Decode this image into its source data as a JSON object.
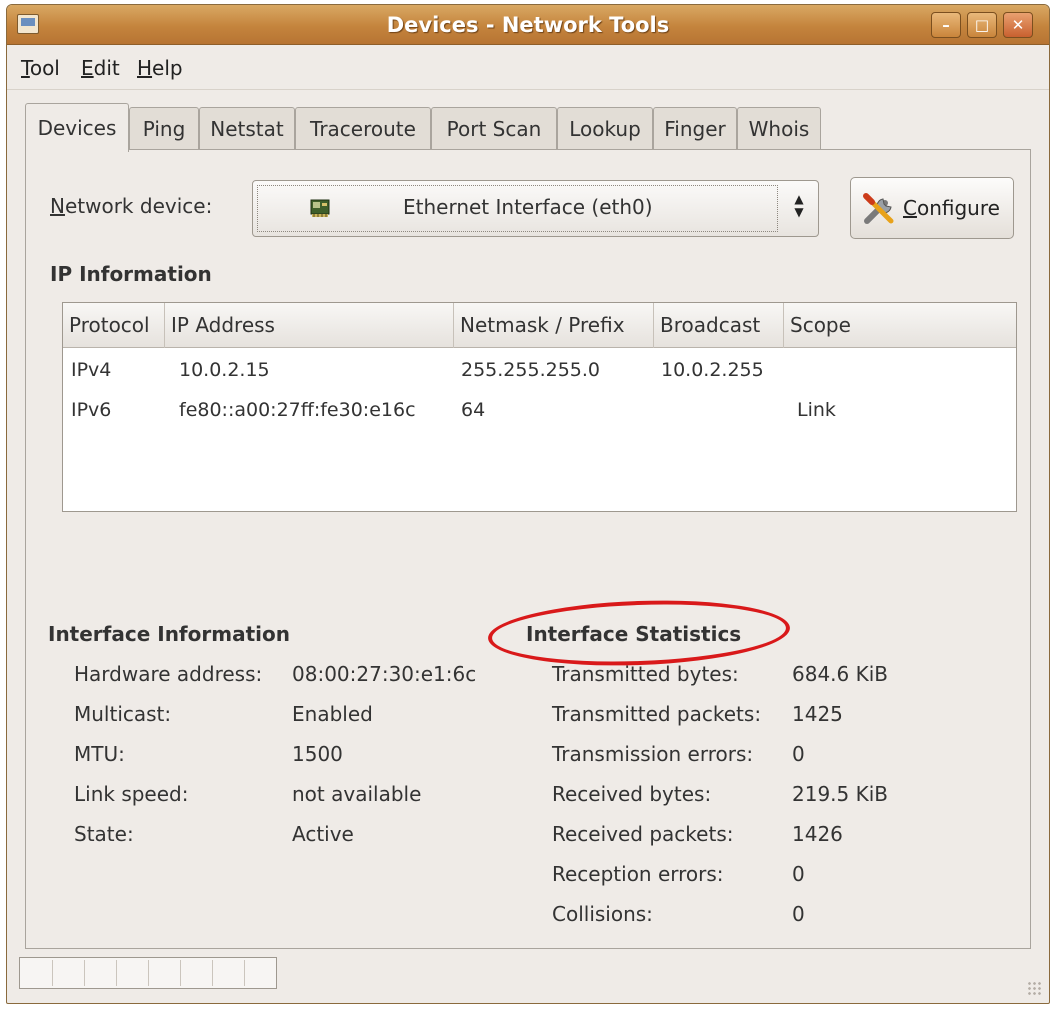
{
  "window": {
    "title": "Devices - Network Tools",
    "controls": {
      "minimize": "–",
      "maximize": "□",
      "close": "✕"
    }
  },
  "menu": {
    "items": [
      {
        "label": "Tool",
        "mnemonic": "T"
      },
      {
        "label": "Edit",
        "mnemonic": "E"
      },
      {
        "label": "Help",
        "mnemonic": "H"
      }
    ]
  },
  "tabs": [
    {
      "label": "Devices",
      "active": true
    },
    {
      "label": "Ping"
    },
    {
      "label": "Netstat"
    },
    {
      "label": "Traceroute"
    },
    {
      "label": "Port Scan"
    },
    {
      "label": "Lookup"
    },
    {
      "label": "Finger"
    },
    {
      "label": "Whois"
    }
  ],
  "device": {
    "label": "Network device:",
    "selected": "Ethernet Interface (eth0)",
    "icon": "network-card-icon",
    "configure_label": "Configure",
    "configure_icon": "tools-icon"
  },
  "ip_info": {
    "heading": "IP Information",
    "columns": [
      "Protocol",
      "IP Address",
      "Netmask / Prefix",
      "Broadcast",
      "Scope"
    ],
    "rows": [
      [
        "IPv4",
        "10.0.2.15",
        "255.255.255.0",
        "10.0.2.255",
        ""
      ],
      [
        "IPv6",
        "fe80::a00:27ff:fe30:e16c",
        "64",
        "",
        "Link"
      ]
    ]
  },
  "interface_info": {
    "heading": "Interface Information",
    "fields": [
      {
        "label": "Hardware address:",
        "value": "08:00:27:30:e1:6c"
      },
      {
        "label": "Multicast:",
        "value": "Enabled"
      },
      {
        "label": "MTU:",
        "value": "1500"
      },
      {
        "label": "Link speed:",
        "value": "not available"
      },
      {
        "label": "State:",
        "value": "Active"
      }
    ]
  },
  "interface_stats": {
    "heading": "Interface Statistics",
    "fields": [
      {
        "label": "Transmitted bytes:",
        "value": "684.6 KiB"
      },
      {
        "label": "Transmitted packets:",
        "value": "1425"
      },
      {
        "label": "Transmission errors:",
        "value": "0"
      },
      {
        "label": "Received bytes:",
        "value": "219.5 KiB"
      },
      {
        "label": "Received packets:",
        "value": "1426"
      },
      {
        "label": "Reception errors:",
        "value": "0"
      },
      {
        "label": "Collisions:",
        "value": "0"
      }
    ]
  },
  "annotation": {
    "color": "#d9191a"
  }
}
